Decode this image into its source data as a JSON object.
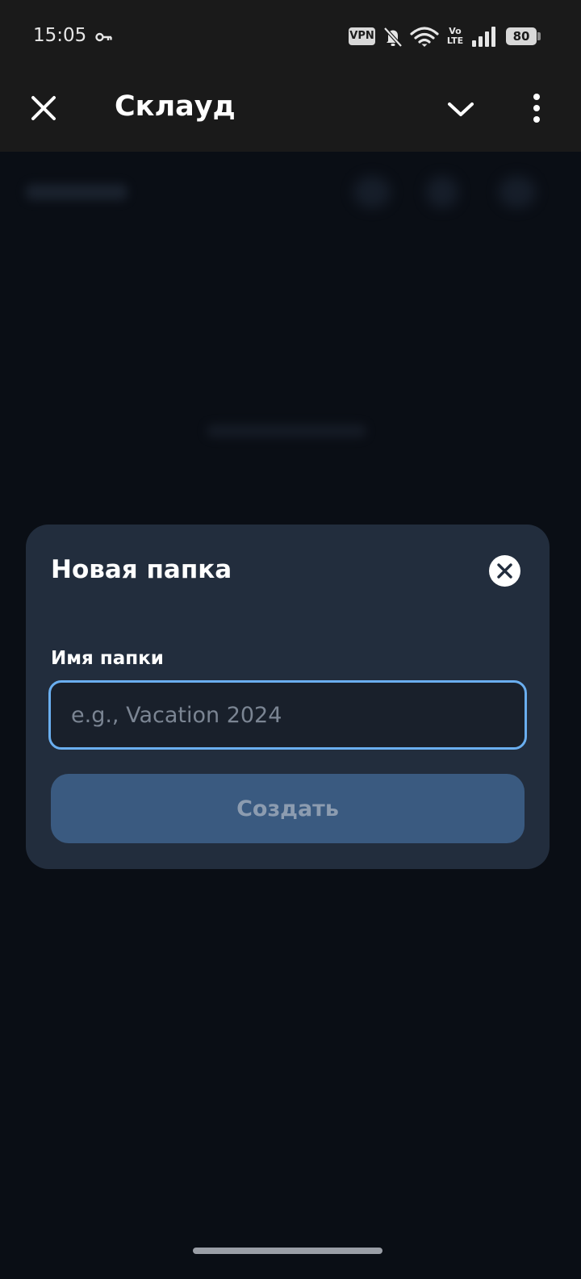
{
  "status_bar": {
    "time": "15:05",
    "vpn_label": "VPN",
    "volte_top": "Vo",
    "volte_bottom": "LTE",
    "battery_level": "80",
    "icons": [
      "key-icon",
      "bell-off-icon",
      "wifi-icon",
      "volte-icon",
      "signal-icon",
      "battery-icon"
    ]
  },
  "app_bar": {
    "title": "Склауд",
    "icons": [
      "close-icon",
      "chevron-down-icon",
      "more-vert-icon"
    ]
  },
  "dialog": {
    "title": "Новая папка",
    "field_label": "Имя папки",
    "input_value": "",
    "input_placeholder": "e.g., Vacation 2024",
    "create_label": "Создать",
    "icons": [
      "close-circle-icon"
    ]
  },
  "colors": {
    "status_bar_bg": "#1a1a1a",
    "page_bg": "#0a0e15",
    "dialog_bg": "#222d3d",
    "input_bg": "#19202b",
    "input_focus_border": "#6aaeef",
    "button_disabled_bg": "#3a5a80",
    "button_disabled_text": "#8c9cb0"
  }
}
